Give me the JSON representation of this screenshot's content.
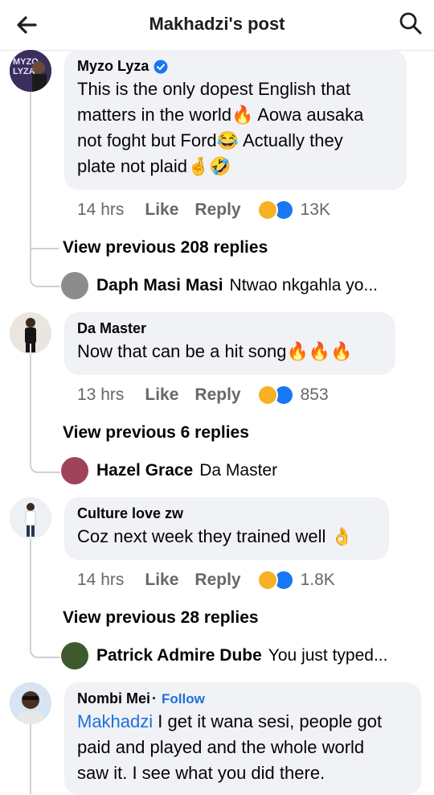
{
  "header": {
    "title": "Makhadzi's post"
  },
  "comments": [
    {
      "author": "Myzo Lyza",
      "verified": true,
      "lines": [
        "This is the only dopest English that",
        "matters in the world🔥 Aowa ausaka",
        "not foght but Ford😂 Actually they",
        "plate not plaid🤞🤣"
      ],
      "time": "14 hrs",
      "like": "Like",
      "reply": "Reply",
      "reactions": "13K",
      "view_previous": "View previous 208 replies",
      "last_reply": {
        "name": "Daph Masi Masi",
        "text": "Ntwao nkgahla yo..."
      }
    },
    {
      "author": "Da Master",
      "lines": [
        "Now that can be a hit song🔥🔥🔥"
      ],
      "time": "13 hrs",
      "like": "Like",
      "reply": "Reply",
      "reactions": "853",
      "view_previous": "View previous 6 replies",
      "last_reply": {
        "name": "Hazel Grace",
        "text": "Da Master"
      }
    },
    {
      "author": "Culture love zw",
      "lines": [
        "Coz next week they trained well 👌"
      ],
      "time": "14 hrs",
      "like": "Like",
      "reply": "Reply",
      "reactions": "1.8K",
      "view_previous": "View previous 28 replies",
      "last_reply": {
        "name": "Patrick Admire Dube",
        "text": "You just typed..."
      }
    },
    {
      "author": "Nombi Mei",
      "separator": "·",
      "follow": "Follow",
      "mention": "Makhadzi",
      "line1_rest": " I get it wana sesi, people got",
      "lines": [
        "paid and played and the whole world",
        "saw it. I see what you did there."
      ]
    }
  ],
  "colors": {
    "link_blue": "#216fdb",
    "bubble_bg": "#f0f2f5",
    "meta_gray": "#65676b",
    "like_blue": "#1877f2",
    "haha_yellow": "#f7b125"
  }
}
